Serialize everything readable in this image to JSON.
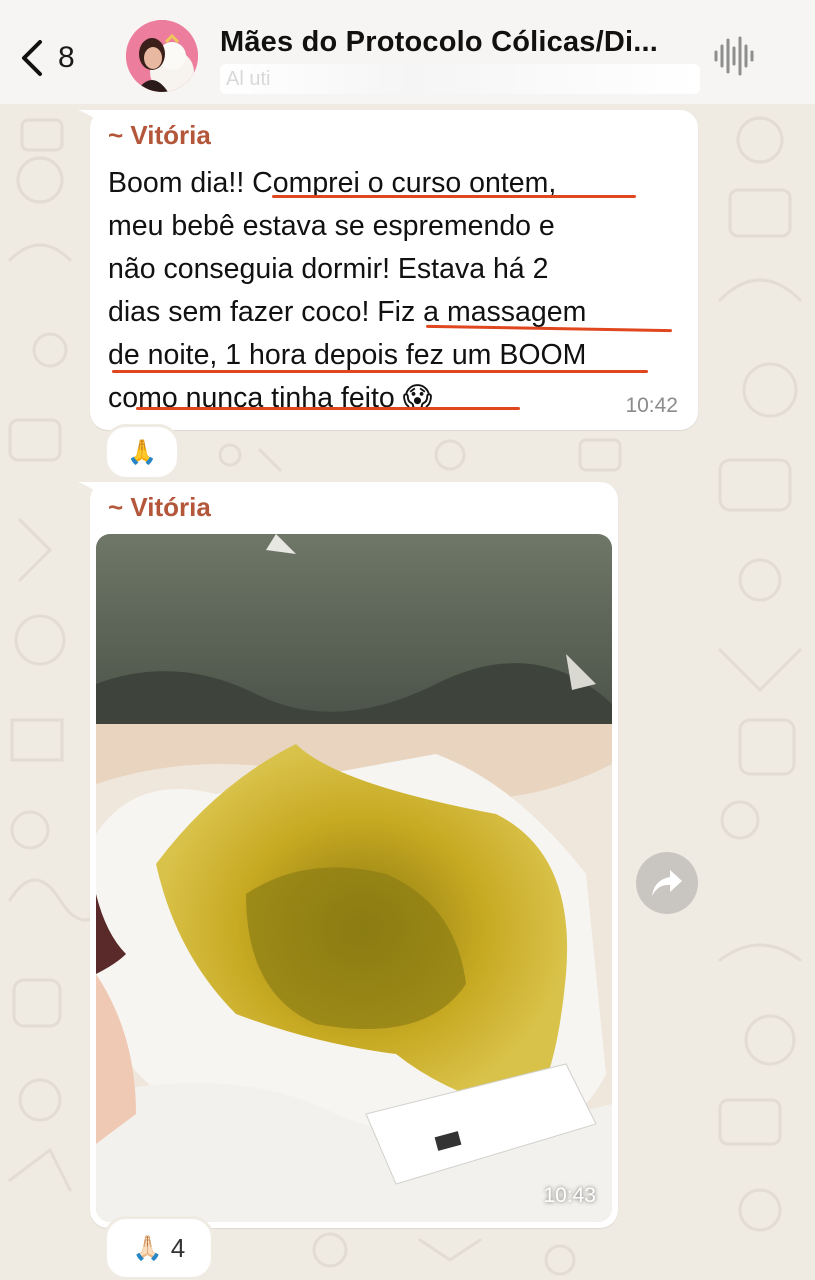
{
  "header": {
    "back_count": "8",
    "title": "Mães do Protocolo  Cólicas/Di...",
    "subtitle": "Al                                                             uti",
    "back_icon": "chevron-left-icon",
    "audio_icon": "audio-waveform-icon"
  },
  "messages": [
    {
      "sender": "~ Vitória",
      "lines": [
        "Boom dia!! Comprei o curso ontem,",
        "meu bebê estava se espremendo e",
        "não conseguia dormir! Estava há 2",
        "dias sem fazer coco! Fiz a massagem",
        "de noite, 1 hora depois fez um BOOM",
        "como nunca tinha feito 😱"
      ],
      "time": "10:42",
      "reaction": {
        "emoji": "🙏",
        "count": ""
      }
    },
    {
      "sender": "~ Vitória",
      "time": "10:43",
      "reaction": {
        "emoji": "🙏🏻",
        "count": "4"
      }
    }
  ],
  "colors": {
    "sender_name": "#b3563a",
    "underline": "#e0471f",
    "chat_background": "#efeae2",
    "bubble": "#ffffff"
  }
}
